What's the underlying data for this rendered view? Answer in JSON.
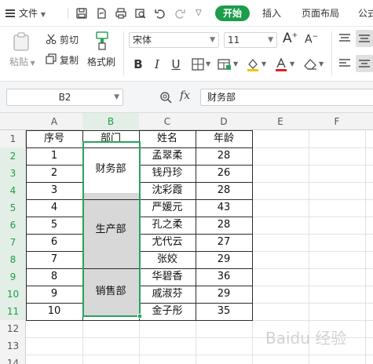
{
  "menubar": {
    "file_label": "文件",
    "tabs": [
      "开始",
      "插入",
      "页面布局",
      "公式"
    ]
  },
  "ribbon": {
    "paste_label": "粘贴",
    "cut_label": "剪切",
    "copy_label": "复制",
    "format_painter_label": "格式刷",
    "font_name": "宋体",
    "font_size": "11",
    "bold": "B",
    "italic": "I",
    "underline": "U",
    "grow_font": "A",
    "shrink_font": "A"
  },
  "formula_bar": {
    "name_box": "B2",
    "fx_label": "fx",
    "content": "财务部"
  },
  "sheet": {
    "columns": [
      "A",
      "B",
      "C",
      "D",
      "E",
      "F"
    ],
    "rows": [
      "1",
      "2",
      "3",
      "4",
      "5",
      "6",
      "7",
      "8",
      "9",
      "10",
      "11",
      "12",
      "13",
      "14"
    ],
    "header": [
      "序号",
      "部门",
      "姓名",
      "年龄"
    ],
    "seq": [
      "1",
      "2",
      "3",
      "4",
      "5",
      "6",
      "7",
      "8",
      "9",
      "10"
    ],
    "names": [
      "孟翠柔",
      "钱丹珍",
      "沈彩霞",
      "严媛元",
      "孔之柔",
      "尤代云",
      "张姣",
      "华碧香",
      "戚淑芬",
      "金子彤"
    ],
    "ages": [
      "28",
      "26",
      "28",
      "43",
      "28",
      "27",
      "29",
      "36",
      "29",
      "35"
    ],
    "departments": [
      "财务部",
      "生产部",
      "销售部"
    ]
  },
  "watermark": "Baidu 经验",
  "colors": {
    "accent_green": "#1b9d4a",
    "selection_green": "#2aa35a",
    "merged_fill": "#d8d8d8"
  }
}
